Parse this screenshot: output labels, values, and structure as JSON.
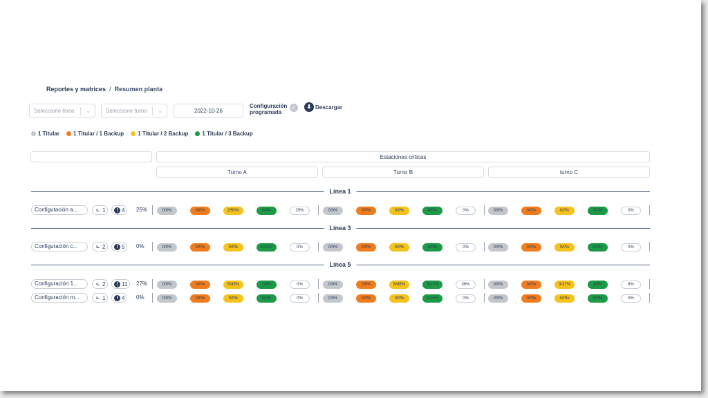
{
  "breadcrumb": {
    "parent": "Reportes y matrices",
    "sep": "/",
    "current": "Resumen planta"
  },
  "filters": {
    "line_placeholder": "Seleccione linea",
    "shift_placeholder": "Seleccione turno",
    "date": "2022-10-26"
  },
  "config": {
    "line1": "Configuración",
    "line2": "programada",
    "check": "✓"
  },
  "download": {
    "icon": "⬇",
    "label": "Descargar"
  },
  "legend": [
    {
      "label": "1 Titular",
      "color": "#c3c6cb"
    },
    {
      "label": "1 Titular / 1 Backup",
      "color": "#ef7d1f"
    },
    {
      "label": "1 Titular / 2 Backup",
      "color": "#f6c21c"
    },
    {
      "label": "1 Titular / 3 Backup",
      "color": "#1d9a46"
    }
  ],
  "table": {
    "group_header": "Estaciones críticas",
    "shifts": [
      "Turno A",
      "Turno B",
      "turno C"
    ]
  },
  "lines": [
    {
      "title": "Línea 1",
      "rows": [
        {
          "name": "Configutación a...",
          "people": "1",
          "alerts": "4",
          "pct": "25%",
          "cells": [
            [
              "0/0%",
              "0/0%",
              "2/50%",
              "0/0%",
              "25%"
            ],
            [
              "0/0%",
              "0/0%",
              "0/0%",
              "0/0%",
              "0%"
            ],
            [
              "0/0%",
              "0/0%",
              "0/0%",
              "0/0%",
              "0%"
            ]
          ]
        }
      ]
    },
    {
      "title": "Línea 3",
      "rows": [
        {
          "name": "Configuración c...",
          "people": "2",
          "alerts": "5",
          "pct": "0%",
          "cells": [
            [
              "0/0%",
              "0/0%",
              "0/0%",
              "1/20%",
              "0%"
            ],
            [
              "0/0%",
              "0/0%",
              "0/0%",
              "0/0%",
              "0%"
            ],
            [
              "0/0%",
              "0/0%",
              "0/0%",
              "0/0%",
              "0%"
            ]
          ]
        }
      ]
    },
    {
      "title": "Línea 5",
      "rows": [
        {
          "name": "Configuración 1...",
          "people": "2",
          "alerts": "11",
          "pct": "27%",
          "cells": [
            [
              "0/0%",
              "0/0%",
              "5/45%",
              "1/9%",
              "0%"
            ],
            [
              "0/0%",
              "0/0%",
              "5/45%",
              "3/27%",
              "36%"
            ],
            [
              "0/0%",
              "0/0%",
              "3/27%",
              "1/9%",
              "9%"
            ]
          ]
        },
        {
          "name": "Configuración m...",
          "people": "1",
          "alerts": "4",
          "pct": "0%",
          "cells": [
            [
              "0/0%",
              "0/0%",
              "0/0%",
              "0/0%",
              "0%"
            ],
            [
              "0/0%",
              "0/0%",
              "0/0%",
              "1/25%",
              "0%"
            ],
            [
              "0/0%",
              "0/0%",
              "0/0%",
              "0/0%",
              "0%"
            ]
          ]
        }
      ]
    }
  ]
}
